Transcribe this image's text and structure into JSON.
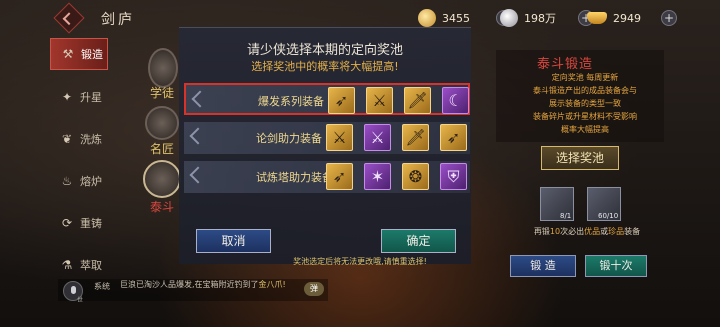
{
  "header": {
    "title": "剑庐"
  },
  "currencies": [
    {
      "icon": "gold-coin-icon",
      "value": "3455"
    },
    {
      "icon": "silver-coin-icon",
      "value": "198万"
    },
    {
      "icon": "gold-ingot-icon",
      "value": "2949"
    }
  ],
  "menu": {
    "items": [
      {
        "label": "锻造",
        "icon": "anvil-icon",
        "active": true
      },
      {
        "label": "升星",
        "icon": "star-icon"
      },
      {
        "label": "洗炼",
        "icon": "leaf-icon"
      },
      {
        "label": "熔炉",
        "icon": "furnace-icon"
      },
      {
        "label": "重铸",
        "icon": "recast-icon"
      },
      {
        "label": "萃取",
        "icon": "extract-icon"
      }
    ]
  },
  "characters": {
    "label1": "学徒",
    "label2": "名匠",
    "label3": "泰斗"
  },
  "modal": {
    "title": "请少侠选择本期的定向奖池",
    "subtitle": "选择奖池中的概率将大幅提高!",
    "pools": [
      {
        "name": "爆发系列装备",
        "selected": true,
        "items": [
          "gold",
          "gold",
          "gold",
          "purple"
        ]
      },
      {
        "name": "论剑助力装备",
        "selected": false,
        "items": [
          "gold",
          "purple",
          "gold",
          "gold"
        ]
      },
      {
        "name": "试炼塔助力装备",
        "selected": false,
        "items": [
          "gold",
          "purple",
          "gold",
          "purple"
        ]
      }
    ],
    "cancel_label": "取消",
    "confirm_label": "确定",
    "warning": "奖池选定后将无法更改哦,请慎重选择!"
  },
  "right_panel": {
    "title": "泰斗锻造",
    "lines": [
      "定向奖池 每周更新",
      "泰斗锻造产出的成品装备会与",
      "展示装备的类型一致",
      "装备碎片或升星材料不受影响",
      "概率大幅提高"
    ],
    "select_pool_label": "选择奖池",
    "materials": [
      {
        "count": "8/1"
      },
      {
        "count": "60/10"
      }
    ],
    "note_pre": "再锻",
    "note_num": "10",
    "note_mid": "次必出",
    "note_q1": "优品",
    "note_or": "或",
    "note_q2": "珍品",
    "note_post": "装备",
    "forge_once_label": "锻 造",
    "forge_ten_label": "锻十次"
  },
  "chat": {
    "channel": "世",
    "sys_label": "系统",
    "msg_pre": "巨浪已淘沙人品爆发,在宝箱附近钓到了",
    "msg_item": "金八爪!",
    "toggle": "弹"
  }
}
